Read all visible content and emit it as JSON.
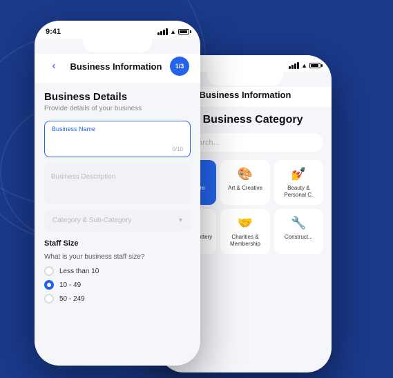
{
  "background": {
    "color": "#1a3a8c"
  },
  "phone_front": {
    "status_bar": {
      "time": "9:41"
    },
    "header": {
      "back_label": "‹",
      "title": "Business Information",
      "progress": "1/3"
    },
    "content": {
      "section_title": "Business Details",
      "section_subtitle": "Provide details of your business",
      "business_name_label": "Business Name",
      "business_name_value": "",
      "business_name_counter": "0/10",
      "business_description_placeholder": "Business Description",
      "category_placeholder": "Category & Sub-Category",
      "staff_size_label": "Staff Size",
      "staff_question": "What is your business staff size?",
      "radio_options": [
        {
          "label": "Less than 10",
          "selected": false
        },
        {
          "label": "10 - 49",
          "selected": true
        },
        {
          "label": "50 - 249",
          "selected": false
        }
      ]
    }
  },
  "phone_back": {
    "header": {
      "title": "Business Information"
    },
    "content": {
      "section_title": "Select Business Category",
      "search_placeholder": "Search...",
      "categories_row1": [
        {
          "name": "Agriculture",
          "icon": "🌾",
          "active": true
        },
        {
          "name": "Art & Creative",
          "icon": "🎨",
          "active": false
        },
        {
          "name": "Beauty & Personal C.",
          "icon": "💅",
          "active": false
        }
      ],
      "categories_row2": [
        {
          "name": "Betting & Lottery",
          "icon": "🎲",
          "active": false
        },
        {
          "name": "Charities & Membership",
          "icon": "🤝",
          "active": false
        },
        {
          "name": "Construct...",
          "icon": "🔧",
          "active": false
        }
      ]
    }
  }
}
